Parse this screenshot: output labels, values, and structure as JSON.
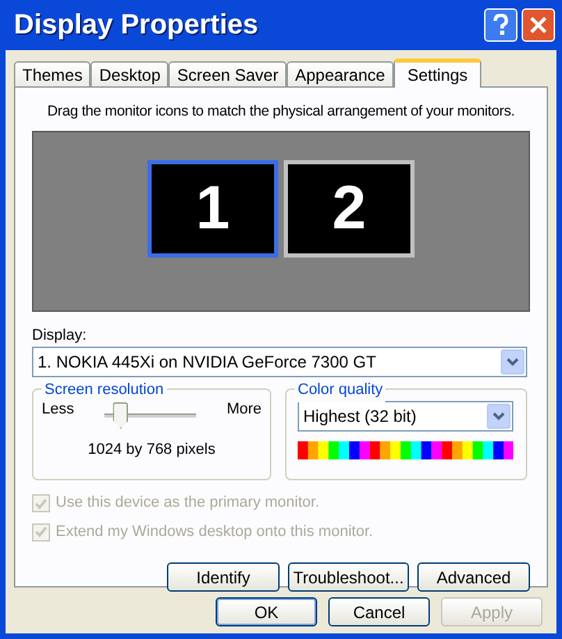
{
  "window": {
    "title": "Display Properties"
  },
  "tabs": [
    {
      "label": "Themes",
      "selected": false
    },
    {
      "label": "Desktop",
      "selected": false
    },
    {
      "label": "Screen Saver",
      "selected": false
    },
    {
      "label": "Appearance",
      "selected": false
    },
    {
      "label": "Settings",
      "selected": true
    }
  ],
  "instruction": "Drag the monitor icons to match the physical arrangement of your monitors.",
  "monitors": [
    {
      "label": "1",
      "selected": true
    },
    {
      "label": "2",
      "selected": false
    }
  ],
  "display": {
    "label": "Display:",
    "value": "1. NOKIA 445Xi on NVIDIA GeForce 7300 GT"
  },
  "resolution": {
    "title": "Screen resolution",
    "less": "Less",
    "more": "More",
    "level": 0.17,
    "reading": "1024 by 768 pixels"
  },
  "color_quality": {
    "title": "Color quality",
    "value": "Highest (32 bit)"
  },
  "checkboxes": [
    {
      "label": "Use this device as the primary monitor.",
      "checked": true,
      "disabled": true
    },
    {
      "label": "Extend my Windows desktop onto this monitor.",
      "checked": true,
      "disabled": true
    }
  ],
  "panel_buttons": [
    {
      "label": "Identify",
      "disabled": false
    },
    {
      "label": "Troubleshoot...",
      "disabled": false
    },
    {
      "label": "Advanced",
      "disabled": false
    }
  ],
  "dialog_buttons": [
    {
      "label": "OK",
      "disabled": false,
      "default": true
    },
    {
      "label": "Cancel",
      "disabled": false,
      "default": false
    },
    {
      "label": "Apply",
      "disabled": true,
      "default": false
    }
  ]
}
